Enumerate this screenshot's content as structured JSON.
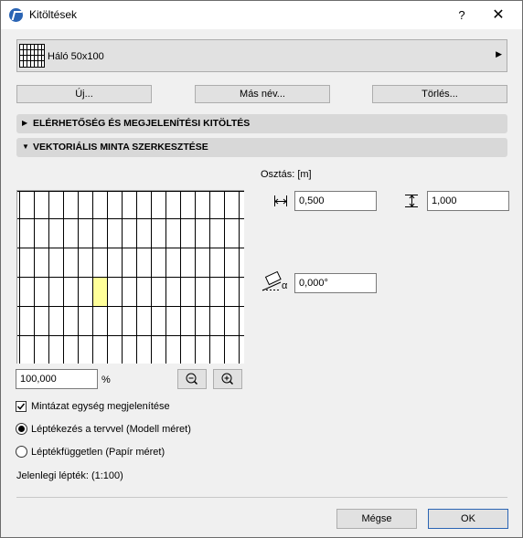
{
  "window": {
    "title": "Kitöltések"
  },
  "titlebar": {
    "help": "?",
    "close": "✕"
  },
  "fill": {
    "name": "Háló 50x100"
  },
  "buttons": {
    "new": "Új...",
    "rename": "Más név...",
    "delete": "Törlés..."
  },
  "sections": {
    "availability": "ELÉRHETŐSÉG ÉS MEGJELENÍTÉSI KITÖLTÉS",
    "vector": "VEKTORIÁLIS MINTA SZERKESZTÉSE"
  },
  "spacing": {
    "label": "Osztás: [m]",
    "horizontal": "0,500",
    "vertical": "1,000",
    "angle": "0,000°",
    "angle_symbol": "α"
  },
  "zoom": {
    "value": "100,000",
    "unit": "%"
  },
  "options": {
    "show_unit": "Mintázat egység megjelenítése",
    "show_unit_checked": true,
    "scale_model": "Léptékezés a tervvel (Modell méret)",
    "scale_paper": "Léptékfüggetlen (Papír méret)",
    "selected": "model"
  },
  "current_scale": "Jelenlegi lépték: (1:100)",
  "footer": {
    "cancel": "Mégse",
    "ok": "OK"
  },
  "colors": {
    "highlight": "#ffff99",
    "accent_border": "#2a64b4"
  }
}
